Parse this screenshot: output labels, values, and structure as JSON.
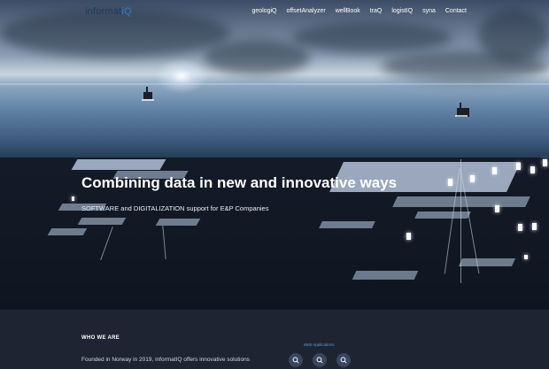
{
  "header": {
    "logo_main": "informat",
    "logo_accent": "iQ",
    "nav_items": [
      "geologiQ",
      "offsetAnalyzer",
      "wellBook",
      "traQ",
      "logistIQ",
      "syna",
      "Contact"
    ]
  },
  "hero": {
    "headline": "Combining data in new and innovative ways",
    "subline": "SOFTWARE and DIGITALIZATION support for E&P Companies"
  },
  "about": {
    "heading": "WHO WE ARE",
    "text": "Founded in Norway in 2019, informatIQ offers innovative solutions",
    "apps_label": "Web Applications"
  },
  "colors": {
    "brand_dark": "#1e3a5c",
    "brand_accent": "#2a7fc8",
    "section_bg": "#1f2433"
  }
}
